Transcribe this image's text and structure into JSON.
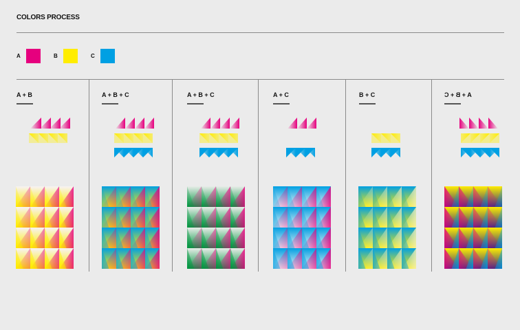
{
  "title": "COLORS PROCESS",
  "colors": {
    "A": "#e6007e",
    "B": "#ffed00",
    "C": "#00a0e3",
    "green": "#009640",
    "purple": "#2d2e83",
    "orange": "#f39200"
  },
  "legend": [
    {
      "label": "A",
      "color": "#e6007e",
      "name": "magenta"
    },
    {
      "label": "B",
      "color": "#ffed00",
      "name": "yellow"
    },
    {
      "label": "C",
      "color": "#00a0e3",
      "name": "cyan"
    }
  ],
  "columns": [
    {
      "label": "A + B",
      "flipped": false,
      "small_rows": [
        "A",
        "B"
      ]
    },
    {
      "label": "A + B + C",
      "flipped": false,
      "small_rows": [
        "A",
        "B",
        "C"
      ]
    },
    {
      "label": "A + B + C",
      "flipped": false,
      "small_rows": [
        "A",
        "B",
        "C"
      ]
    },
    {
      "label": "A + C",
      "flipped": false,
      "small_rows": [
        "A",
        "C"
      ]
    },
    {
      "label": "B + C",
      "flipped": false,
      "small_rows": [
        "B",
        "C"
      ]
    },
    {
      "label": "A + B + C",
      "flipped": true,
      "small_rows": [
        "A",
        "B",
        "C"
      ]
    }
  ]
}
